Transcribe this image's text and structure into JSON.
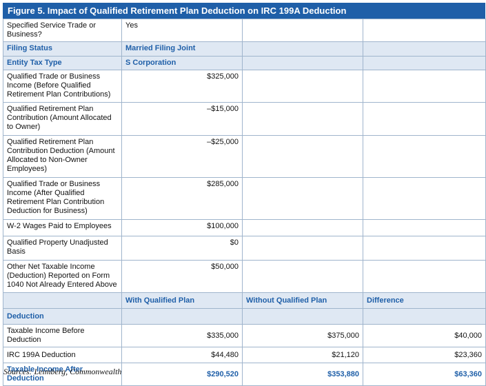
{
  "title": "Figure 5. Impact of Qualified Retirement Plan Deduction on IRC 199A Deduction",
  "rows": [
    {
      "label": "Specified Service Trade or Business?",
      "value": "Yes"
    },
    {
      "label": "Filing Status",
      "value": "Married Filing Joint"
    },
    {
      "label": "Entity Tax Type",
      "value": "S Corporation"
    },
    {
      "label": "Qualified Trade or Business Income (Before Qualified Retirement Plan Contributions)",
      "value": "$325,000"
    },
    {
      "label": "Qualified Retirement Plan Contribution (Amount Allocated to Owner)",
      "value": "–$15,000"
    },
    {
      "label": "Qualified Retirement Plan Contribution Deduction (Amount Allocated to Non-Owner Employees)",
      "value": "–$25,000"
    },
    {
      "label": "Qualified Trade or Business Income (After Qualified Retirement Plan Contribution Deduction for Business)",
      "value": "$285,000"
    },
    {
      "label": "W-2 Wages Paid to Employees",
      "value": "$100,000"
    },
    {
      "label": "Qualified Property Unadjusted Basis",
      "value": "$0"
    },
    {
      "label": "Other Net Taxable Income (Deduction) Reported on Form 1040 Not Already Entered Above",
      "value": "$50,000"
    }
  ],
  "compare_headers": [
    "With Qualified Plan",
    "Without Qualified Plan",
    "Difference"
  ],
  "section_label": "Deduction",
  "compare_rows": [
    {
      "label": "Taxable Income Before Deduction",
      "with": "$335,000",
      "without": "$375,000",
      "diff": "$40,000"
    },
    {
      "label": "IRC 199A Deduction",
      "with": "$44,480",
      "without": "$21,120",
      "diff": "$23,360"
    },
    {
      "label": "Taxable Income After Deduction",
      "with": "$290,520",
      "without": "$353,880",
      "diff": "$63,360"
    }
  ],
  "source": "Sources: Leimberg, Commonwealth",
  "colors": {
    "accent": "#1f5fa8",
    "header_fill": "#dfe8f3",
    "border": "#9fb4cc"
  }
}
